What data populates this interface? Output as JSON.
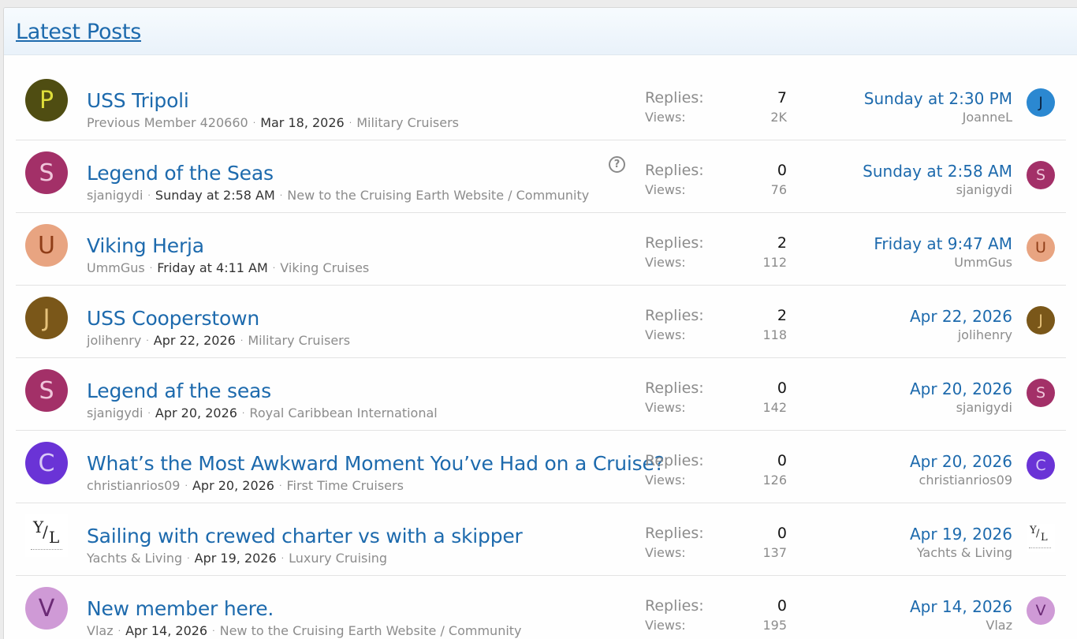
{
  "header": {
    "title": "Latest Posts"
  },
  "labels": {
    "replies": "Replies:",
    "views": "Views:"
  },
  "threads": [
    {
      "title": "USS Tripoli",
      "author": "Previous Member 420660",
      "date": "Mar 18, 2026",
      "forum": "Military Cruisers",
      "replies": "7",
      "views": "2K",
      "last_date": "Sunday at 2:30 PM",
      "last_user": "JoanneL",
      "avatar_letter": "P",
      "avatar_color": "#4f4d12",
      "avatar_text_color": "#dede3a",
      "last_avatar_letter": "J",
      "last_avatar_color": "#2b88d1",
      "last_avatar_text_color": "#0b2340",
      "help": false
    },
    {
      "title": "Legend of the Seas",
      "author": "sjanigydi",
      "date": "Sunday at 2:58 AM",
      "forum": "New to the Cruising Earth Website / Community",
      "replies": "0",
      "views": "76",
      "last_date": "Sunday at 2:58 AM",
      "last_user": "sjanigydi",
      "avatar_letter": "S",
      "avatar_color": "#a33068",
      "avatar_text_color": "#f0c6db",
      "last_avatar_letter": "S",
      "last_avatar_color": "#a33068",
      "last_avatar_text_color": "#f0c6db",
      "help": true
    },
    {
      "title": "Viking Herja",
      "author": "UmmGus",
      "date": "Friday at 4:11 AM",
      "forum": "Viking Cruises",
      "replies": "2",
      "views": "112",
      "last_date": "Friday at 9:47 AM",
      "last_user": "UmmGus",
      "avatar_letter": "U",
      "avatar_color": "#e8a481",
      "avatar_text_color": "#8f3d17",
      "last_avatar_letter": "U",
      "last_avatar_color": "#e8a481",
      "last_avatar_text_color": "#8f3d17",
      "help": false
    },
    {
      "title": "USS Cooperstown",
      "author": "jolihenry",
      "date": "Apr 22, 2026",
      "forum": "Military Cruisers",
      "replies": "2",
      "views": "118",
      "last_date": "Apr 22, 2026",
      "last_user": "jolihenry",
      "avatar_letter": "J",
      "avatar_color": "#7a5719",
      "avatar_text_color": "#e6c27a",
      "last_avatar_letter": "J",
      "last_avatar_color": "#7a5719",
      "last_avatar_text_color": "#e6c27a",
      "help": false
    },
    {
      "title": "Legend af the seas",
      "author": "sjanigydi",
      "date": "Apr 20, 2026",
      "forum": "Royal Caribbean International",
      "replies": "0",
      "views": "142",
      "last_date": "Apr 20, 2026",
      "last_user": "sjanigydi",
      "avatar_letter": "S",
      "avatar_color": "#a33068",
      "avatar_text_color": "#f0c6db",
      "last_avatar_letter": "S",
      "last_avatar_color": "#a33068",
      "last_avatar_text_color": "#f0c6db",
      "help": false
    },
    {
      "title": "What’s the Most Awkward Moment You’ve Had on a Cruise?",
      "author": "christianrios09",
      "date": "Apr 20, 2026",
      "forum": "First Time Cruisers",
      "replies": "0",
      "views": "126",
      "last_date": "Apr 20, 2026",
      "last_user": "christianrios09",
      "avatar_letter": "C",
      "avatar_color": "#6a33d6",
      "avatar_text_color": "#d9c9f7",
      "last_avatar_letter": "C",
      "last_avatar_color": "#6a33d6",
      "last_avatar_text_color": "#d9c9f7",
      "help": false
    },
    {
      "title": "Sailing with crewed charter vs with a skipper",
      "author": "Yachts & Living",
      "date": "Apr 19, 2026",
      "forum": "Luxury Cruising",
      "replies": "0",
      "views": "137",
      "last_date": "Apr 19, 2026",
      "last_user": "Yachts & Living",
      "avatar_letter": "",
      "avatar_color": "#ffffff",
      "avatar_text_color": "#222222",
      "last_avatar_letter": "",
      "last_avatar_color": "#ffffff",
      "last_avatar_text_color": "#222222",
      "logo": true,
      "help": false
    },
    {
      "title": "New member here.",
      "author": "Vlaz",
      "date": "Apr 14, 2026",
      "forum": "New to the Cruising Earth Website / Community",
      "replies": "0",
      "views": "195",
      "last_date": "Apr 14, 2026",
      "last_user": "Vlaz",
      "avatar_letter": "V",
      "avatar_color": "#cf9ad6",
      "avatar_text_color": "#6b2a75",
      "last_avatar_letter": "V",
      "last_avatar_color": "#cf9ad6",
      "last_avatar_text_color": "#6b2a75",
      "help": false
    }
  ]
}
